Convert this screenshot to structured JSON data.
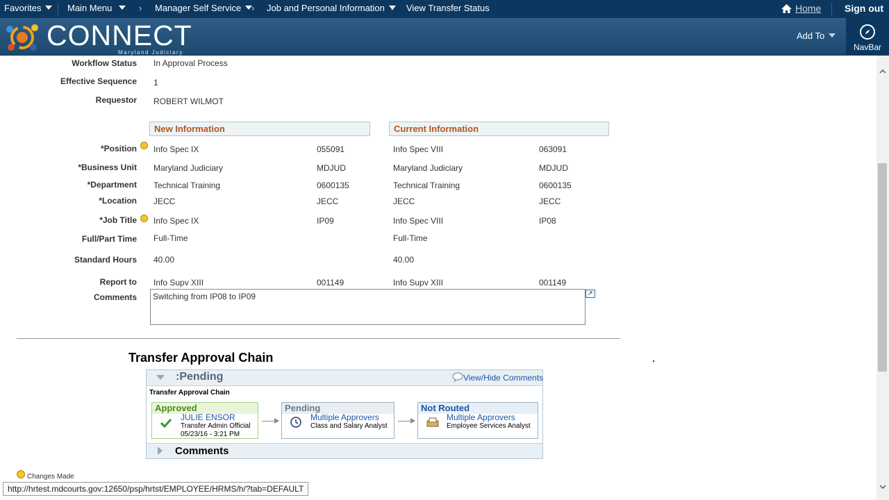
{
  "topnav": {
    "favorites": "Favorites",
    "main_menu": "Main Menu",
    "manager_self_service": "Manager Self Service",
    "job_personal_info": "Job and Personal Information",
    "view_transfer_status": "View Transfer Status",
    "home": "Home",
    "sign_out": "Sign out"
  },
  "header": {
    "logo_text": "CONNECT",
    "logo_sub": "Maryland Judiciary",
    "add_to": "Add To",
    "navbar": "NavBar"
  },
  "summary": {
    "workflow_status_label": "Workflow Status",
    "workflow_status_value": "In Approval Process",
    "effective_sequence_label": "Effective Sequence",
    "effective_sequence_value": "1",
    "requestor_label": "Requestor",
    "requestor_value": "ROBERT WILMOT"
  },
  "sections": {
    "new_info": "New Information",
    "current_info": "Current Information"
  },
  "rows": [
    {
      "label": "*Position",
      "new_desc": "Info Spec IX",
      "new_code": "055091",
      "cur_desc": "Info Spec VIII",
      "cur_code": "063091"
    },
    {
      "label": "*Business Unit",
      "new_desc": "Maryland Judiciary",
      "new_code": "MDJUD",
      "cur_desc": "Maryland Judiciary",
      "cur_code": "MDJUD"
    },
    {
      "label": "*Department",
      "new_desc": "Technical Training",
      "new_code": "0600135",
      "cur_desc": "Technical Training",
      "cur_code": "0600135"
    },
    {
      "label": "*Location",
      "new_desc": "JECC",
      "new_code": "JECC",
      "cur_desc": "JECC",
      "cur_code": "JECC"
    },
    {
      "label": "*Job Title",
      "new_desc": "Info Spec IX",
      "new_code": "IP09",
      "cur_desc": "Info Spec VIII",
      "cur_code": "IP08"
    },
    {
      "label": "Full/Part Time",
      "new_desc": "Full-Time",
      "new_code": "",
      "cur_desc": "Full-Time",
      "cur_code": ""
    },
    {
      "label": "Standard Hours",
      "new_desc": "40.00",
      "new_code": "",
      "cur_desc": "40.00",
      "cur_code": ""
    },
    {
      "label": "Report to",
      "new_desc": "Info Supv XIII",
      "new_code": "001149",
      "cur_desc": "Info Supv XIII",
      "cur_code": "001149"
    }
  ],
  "comments": {
    "label": "Comments",
    "value": "Switching from IP08 to IP09"
  },
  "chain": {
    "title": "Transfer Approval Chain",
    "status": ":Pending",
    "view_hide": "View/Hide Comments",
    "subtitle": "Transfer Approval Chain",
    "steps": [
      {
        "state": "Approved",
        "who": "JULIE ENSOR",
        "role": "Transfer Admin Official",
        "date": "05/23/16 - 3:21 PM",
        "color": "#4c8a1e"
      },
      {
        "state": "Pending",
        "who": "Multiple Approvers",
        "role": "Class and Salary Analyst",
        "color": "#6b7d8c"
      },
      {
        "state": "Not Routed",
        "who": "Multiple Approvers",
        "role": "Employee Services Analyst",
        "color": "#1d55a3"
      }
    ],
    "comments_label": "Comments"
  },
  "legend": {
    "changes_made": "Changes Made"
  },
  "status_url": "http://hrtest.mdcourts.gov:12650/psp/hrtst/EMPLOYEE/HRMS/h/?tab=DEFAULT"
}
